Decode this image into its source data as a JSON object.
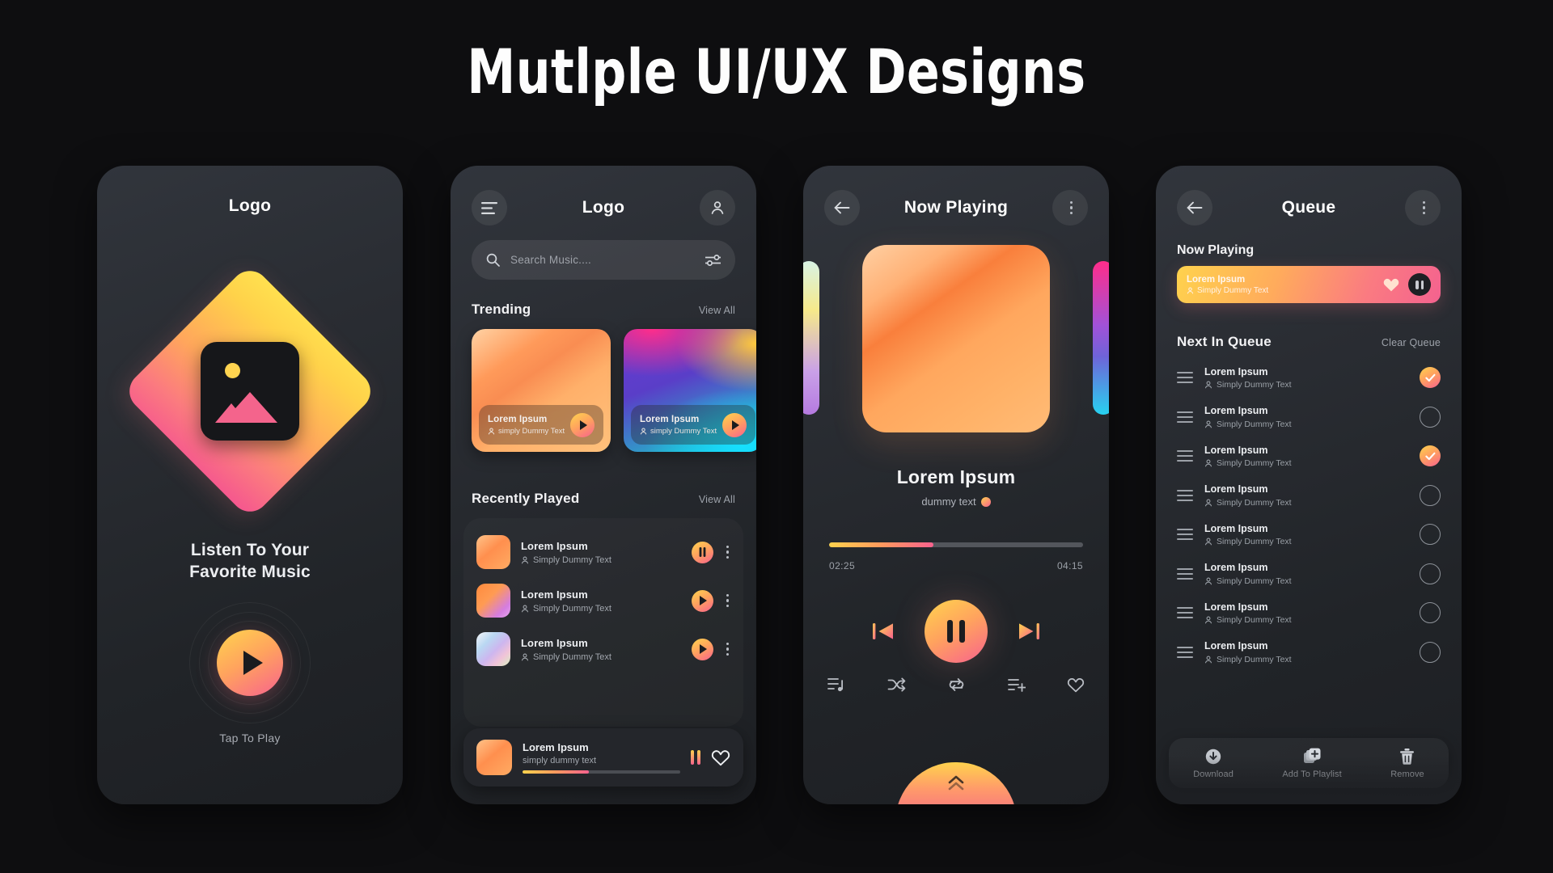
{
  "page": {
    "title": "Mutlple UI/UX Designs"
  },
  "colors": {
    "background": "#0e0e10",
    "phone_bg": "#2a2d33",
    "accent_yellow": "#ffd44e",
    "accent_orange": "#ffa25e",
    "accent_pink": "#f8628e",
    "text_primary": "#f2f2f4",
    "text_secondary": "#9ea3ab"
  },
  "screen1": {
    "title": "Logo",
    "tagline_line1": "Listen To Your",
    "tagline_line2": "Favorite Music",
    "tap_label": "Tap To Play",
    "icons": {
      "play": "play-icon",
      "image": "image-placeholder-icon"
    }
  },
  "screen2": {
    "title": "Logo",
    "menu_icon": "hamburger-menu-icon",
    "profile_icon": "user-profile-icon",
    "search": {
      "placeholder": "Search Music....",
      "value": "",
      "search_icon": "search-icon",
      "filter_icon": "filter-sliders-icon"
    },
    "trending": {
      "heading": "Trending",
      "view_all": "View All",
      "cards": [
        {
          "title": "Lorem Ipsum",
          "subtitle": "simply Dummy Text",
          "play_icon": "play-icon"
        },
        {
          "title": "Lorem Ipsum",
          "subtitle": "simply Dummy Text",
          "play_icon": "play-icon"
        }
      ]
    },
    "recent": {
      "heading": "Recently Played",
      "view_all": "View All",
      "rows": [
        {
          "title": "Lorem Ipsum",
          "subtitle": "Simply Dummy Text",
          "state": "pause",
          "menu_icon": "more-vertical-icon"
        },
        {
          "title": "Lorem Ipsum",
          "subtitle": "Simply Dummy Text",
          "state": "play",
          "menu_icon": "more-vertical-icon"
        },
        {
          "title": "Lorem Ipsum",
          "subtitle": "Simply Dummy Text",
          "state": "play",
          "menu_icon": "more-vertical-icon"
        }
      ]
    },
    "mini_player": {
      "title": "Lorem Ipsum",
      "subtitle": "simply dummy text",
      "progress_percent": 42,
      "pause_icon": "pause-icon",
      "favorite_icon": "heart-outline-icon"
    }
  },
  "screen3": {
    "title": "Now Playing",
    "back_icon": "arrow-left-icon",
    "menu_icon": "more-vertical-icon",
    "track_title": "Lorem Ipsum",
    "track_subtitle": "dummy text",
    "verified_badge": "verified-badge-icon",
    "time_current": "02:25",
    "time_total": "04:15",
    "progress_percent": 41,
    "controls": {
      "previous": "skip-previous-icon",
      "pause": "pause-icon",
      "next": "skip-next-icon"
    },
    "extra_controls": [
      "queue-list-icon",
      "shuffle-icon",
      "repeat-icon",
      "add-to-playlist-icon",
      "heart-outline-icon"
    ],
    "sheet_handle_icon": "double-chevron-up-icon"
  },
  "screen4": {
    "title": "Queue",
    "back_icon": "arrow-left-icon",
    "menu_icon": "more-vertical-icon",
    "now_playing_label": "Now Playing",
    "now_playing": {
      "title": "Lorem Ipsum",
      "subtitle": "Simply Dummy Text",
      "favorite_icon": "heart-filled-icon",
      "pause_icon": "pause-icon"
    },
    "next_heading": "Next In Queue",
    "clear_queue": "Clear Queue",
    "queue_rows": [
      {
        "title": "Lorem Ipsum",
        "subtitle": "Simply Dummy Text",
        "checked": true,
        "drag_icon": "drag-handle-icon"
      },
      {
        "title": "Lorem Ipsum",
        "subtitle": "Simply Dummy Text",
        "checked": false,
        "drag_icon": "drag-handle-icon"
      },
      {
        "title": "Lorem Ipsum",
        "subtitle": "Simply Dummy Text",
        "checked": true,
        "drag_icon": "drag-handle-icon"
      },
      {
        "title": "Lorem Ipsum",
        "subtitle": "Simply Dummy Text",
        "checked": false,
        "drag_icon": "drag-handle-icon"
      },
      {
        "title": "Lorem Ipsum",
        "subtitle": "Simply Dummy Text",
        "checked": false,
        "drag_icon": "drag-handle-icon"
      },
      {
        "title": "Lorem Ipsum",
        "subtitle": "Simply Dummy Text",
        "checked": false,
        "drag_icon": "drag-handle-icon"
      },
      {
        "title": "Lorem Ipsum",
        "subtitle": "Simply Dummy Text",
        "checked": false,
        "drag_icon": "drag-handle-icon"
      },
      {
        "title": "Lorem Ipsum",
        "subtitle": "Simply Dummy Text",
        "checked": false,
        "drag_icon": "drag-handle-icon"
      }
    ],
    "actions": [
      {
        "label": "Download",
        "icon": "download-icon"
      },
      {
        "label": "Add To Playlist",
        "icon": "add-to-playlist-icon"
      },
      {
        "label": "Remove",
        "icon": "trash-icon"
      }
    ]
  }
}
